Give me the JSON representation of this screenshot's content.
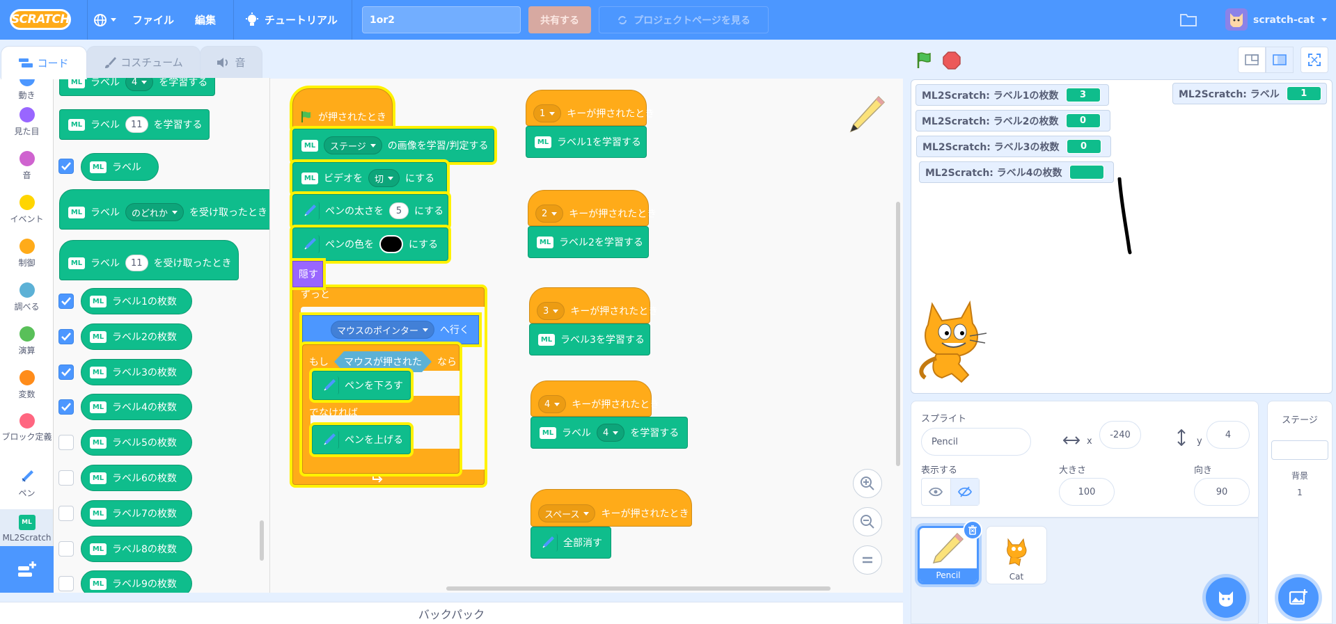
{
  "menubar": {
    "logo": "SCRATCH",
    "file": "ファイル",
    "edit": "編集",
    "tutorials": "チュートリアル",
    "project_title": "1or2",
    "share": "共有する",
    "see_project_page": "プロジェクトページを見る",
    "username": "scratch-cat"
  },
  "tabs": {
    "code": "コード",
    "costumes": "コスチューム",
    "sounds": "音"
  },
  "categories": [
    {
      "label": "動き",
      "color": "#4c97ff"
    },
    {
      "label": "見た目",
      "color": "#9966ff"
    },
    {
      "label": "音",
      "color": "#cf63cf"
    },
    {
      "label": "イベント",
      "color": "#ffd500"
    },
    {
      "label": "制御",
      "color": "#ffab19"
    },
    {
      "label": "調べる",
      "color": "#5cb1d6"
    },
    {
      "label": "演算",
      "color": "#59c059"
    },
    {
      "label": "変数",
      "color": "#ff8c1a"
    },
    {
      "label": "ブロック定義",
      "color": "#ff6680"
    },
    {
      "label": "ペン",
      "color": "#0fbd8c"
    },
    {
      "label": "ML2Scratch",
      "color": "#0fbd8c"
    }
  ],
  "flyout": {
    "learn_label_top": {
      "pre": "ラベル",
      "num": "4",
      "post": "を学習する"
    },
    "learn_label_11": {
      "pre": "ラベル",
      "num": "11",
      "post": "を学習する"
    },
    "label_reporter": "ラベル",
    "when_receive_any": {
      "pre": "ラベル",
      "dd": "のどれか",
      "post": "を受け取ったとき"
    },
    "when_receive_11": {
      "pre": "ラベル",
      "num": "11",
      "post": "を受け取ったとき"
    },
    "counts": [
      {
        "label": "ラベル1の枚数",
        "checked": true
      },
      {
        "label": "ラベル2の枚数",
        "checked": true
      },
      {
        "label": "ラベル3の枚数",
        "checked": true
      },
      {
        "label": "ラベル4の枚数",
        "checked": true
      },
      {
        "label": "ラベル5の枚数",
        "checked": false
      },
      {
        "label": "ラベル6の枚数",
        "checked": false
      },
      {
        "label": "ラベル7の枚数",
        "checked": false
      },
      {
        "label": "ラベル8の枚数",
        "checked": false
      },
      {
        "label": "ラベル9の枚数",
        "checked": false
      }
    ]
  },
  "script_main": {
    "hat": "が押されたとき",
    "stage_dd": "ステージ",
    "stage_post": "の画像を学習/判定する",
    "video_pre": "ビデオを",
    "video_dd": "切",
    "video_post": "にする",
    "pensize_pre": "ペンの太さを",
    "pensize_val": "5",
    "pensize_post": "にする",
    "pencolor_pre": "ペンの色を",
    "pencolor_post": "にする",
    "hide": "隠す",
    "forever": "ずっと",
    "goto_dd": "マウスのポインター",
    "goto_post": "へ行く",
    "if": "もし",
    "mouse_down": "マウスが押された",
    "then": "なら",
    "pen_down": "ペンを下ろす",
    "else": "でなければ",
    "pen_up": "ペンを上げる"
  },
  "key_scripts": [
    {
      "key": "1",
      "hat_post": "キーが押されたとき",
      "action": "ラベル1を学習する"
    },
    {
      "key": "2",
      "hat_post": "キーが押されたとき",
      "action": "ラベル2を学習する"
    },
    {
      "key": "3",
      "hat_post": "キーが押されたとき",
      "action": "ラベル3を学習する"
    },
    {
      "key": "4",
      "hat_post": "キーが押されたとき",
      "action_pre": "ラベル",
      "action_dd": "4",
      "action_post": "を学習する"
    },
    {
      "key": "スペース",
      "hat_post": "キーが押されたとき",
      "action": "全部消す"
    }
  ],
  "backpack": "バックパック",
  "monitors": [
    {
      "label": "ML2Scratch: ラベル1の枚数",
      "value": "3"
    },
    {
      "label": "ML2Scratch: ラベル2の枚数",
      "value": "0"
    },
    {
      "label": "ML2Scratch: ラベル3の枚数",
      "value": "0"
    },
    {
      "label": "ML2Scratch: ラベル4の枚数",
      "value": ""
    },
    {
      "label": "ML2Scratch: ラベル",
      "value": "1"
    }
  ],
  "sprite_info": {
    "sprite_label": "スプライト",
    "sprite_name": "Pencil",
    "x_label": "x",
    "x_value": "-240",
    "y_label": "y",
    "y_value": "4",
    "show_label": "表示する",
    "size_label": "大きさ",
    "size_value": "100",
    "direction_label": "向き",
    "direction_value": "90"
  },
  "sprites": [
    {
      "name": "Pencil",
      "selected": true
    },
    {
      "name": "Cat",
      "selected": false
    }
  ],
  "stage_pane": {
    "title": "ステージ",
    "backdrops_label": "背景",
    "backdrops_count": "1"
  }
}
